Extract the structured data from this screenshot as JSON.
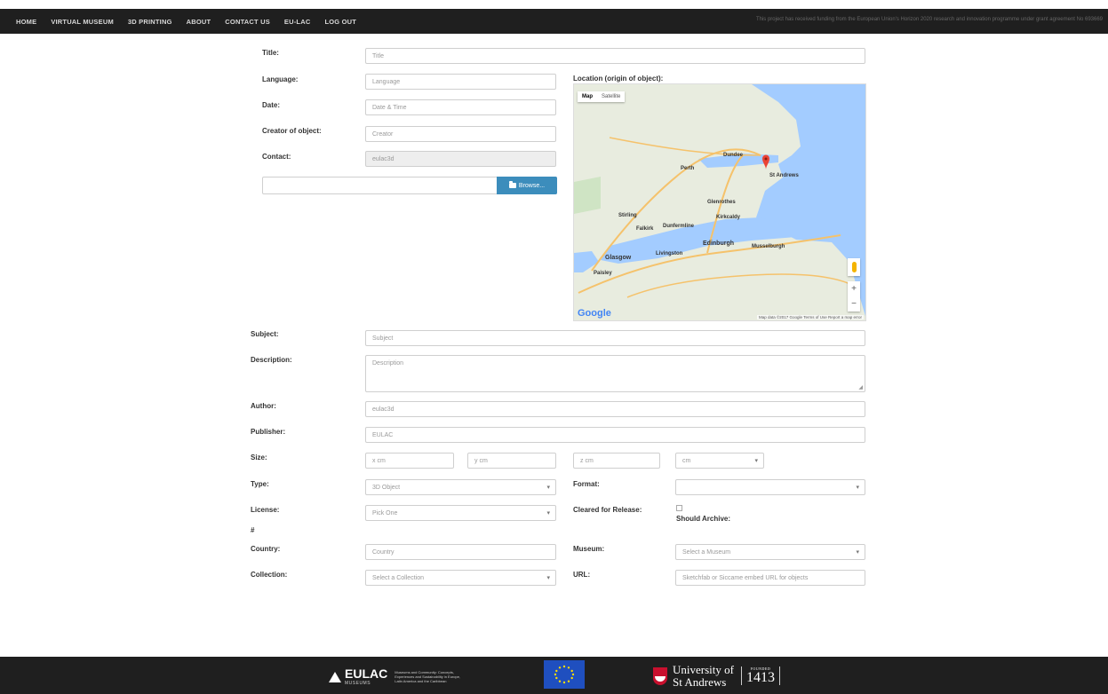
{
  "nav": {
    "items": [
      "HOME",
      "VIRTUAL MUSEUM",
      "3D PRINTING",
      "ABOUT",
      "CONTACT US",
      "EU-LAC",
      "LOG OUT"
    ],
    "notice": "This project has received funding from the European Union's Horizon 2020 research and innovation programme under grant agreement No 693669"
  },
  "form": {
    "title": {
      "label": "Title:",
      "placeholder": "Title"
    },
    "language": {
      "label": "Language:",
      "placeholder": "Language"
    },
    "date": {
      "label": "Date:",
      "placeholder": "Date & Time"
    },
    "creator": {
      "label": "Creator of object:",
      "placeholder": "Creator"
    },
    "contact": {
      "label": "Contact:",
      "value": "eulac3d"
    },
    "browse": {
      "label": "Browse..."
    },
    "location": {
      "label": "Location (origin of object):"
    },
    "subject": {
      "label": "Subject:",
      "placeholder": "Subject"
    },
    "description": {
      "label": "Description:",
      "placeholder": "Description"
    },
    "author": {
      "label": "Author:",
      "value": "eulac3d"
    },
    "publisher": {
      "label": "Publisher:",
      "value": "EULAC"
    },
    "size": {
      "label": "Size:",
      "x": "x cm",
      "y": "y cm",
      "z": "z cm",
      "unit": "cm"
    },
    "type": {
      "label": "Type:",
      "value": "3D Object"
    },
    "format": {
      "label": "Format:",
      "value": ""
    },
    "license": {
      "label": "License:",
      "value": "Pick One"
    },
    "cleared": {
      "label": "Cleared for Release:"
    },
    "should_archive": {
      "label": "Should Archive:"
    },
    "hash": {
      "label": "#"
    },
    "country": {
      "label": "Country:",
      "placeholder": "Country"
    },
    "museum": {
      "label": "Museum:",
      "placeholder": "Select a Museum"
    },
    "collection": {
      "label": "Collection:",
      "placeholder": "Select a Collection"
    },
    "url": {
      "label": "URL:",
      "placeholder": "Sketchfab or Siccame embed URL for objects"
    }
  },
  "map": {
    "tabs": [
      "Map",
      "Satellite"
    ],
    "labels": [
      "Dundee",
      "St Andrews",
      "Perth",
      "Glenrothes",
      "Kirkcaldy",
      "Dunfermline",
      "Stirling",
      "Edinburgh",
      "Glasgow",
      "Livingston",
      "Paisley",
      "Falkirk",
      "Musselburgh"
    ],
    "google": "Google",
    "footer": "Map data ©2017 Google   Terms of Use   Report a map error",
    "colors": {
      "water": "#a3ccff",
      "land": "#e8ecdf",
      "road": "#f5c26b",
      "pin": "#ea4335"
    }
  },
  "footer": {
    "eulac_name": "EULAC",
    "eulac_sub": "MUSEUMS",
    "eulac_desc": "Museums and Community: Concepts, Experiences and Sustainability in Europe, Latin America and the Caribbean",
    "sa_name_1": "University of",
    "sa_name_2": "St Andrews",
    "sa_founded": "FOUNDED",
    "sa_year": "1413"
  }
}
